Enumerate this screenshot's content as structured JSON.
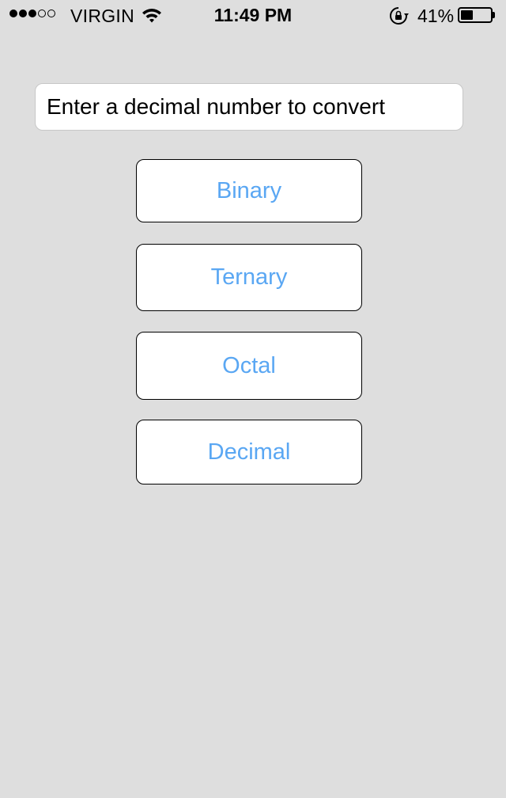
{
  "status_bar": {
    "signal_bars_filled": 3,
    "signal_bars_total": 5,
    "carrier": "VIRGIN",
    "time": "11:49 PM",
    "battery_percent": "41%",
    "battery_level": 0.41,
    "icons": [
      "wifi-icon",
      "rotation-lock-icon",
      "battery-icon"
    ]
  },
  "converter": {
    "input_placeholder": "Enter a decimal number to convert",
    "input_value": "",
    "buttons": [
      {
        "label": "Binary"
      },
      {
        "label": "Ternary"
      },
      {
        "label": "Octal"
      },
      {
        "label": "Decimal"
      }
    ]
  },
  "colors": {
    "background": "#dedede",
    "button_text": "#5aa7f3",
    "button_border": "#000000"
  }
}
